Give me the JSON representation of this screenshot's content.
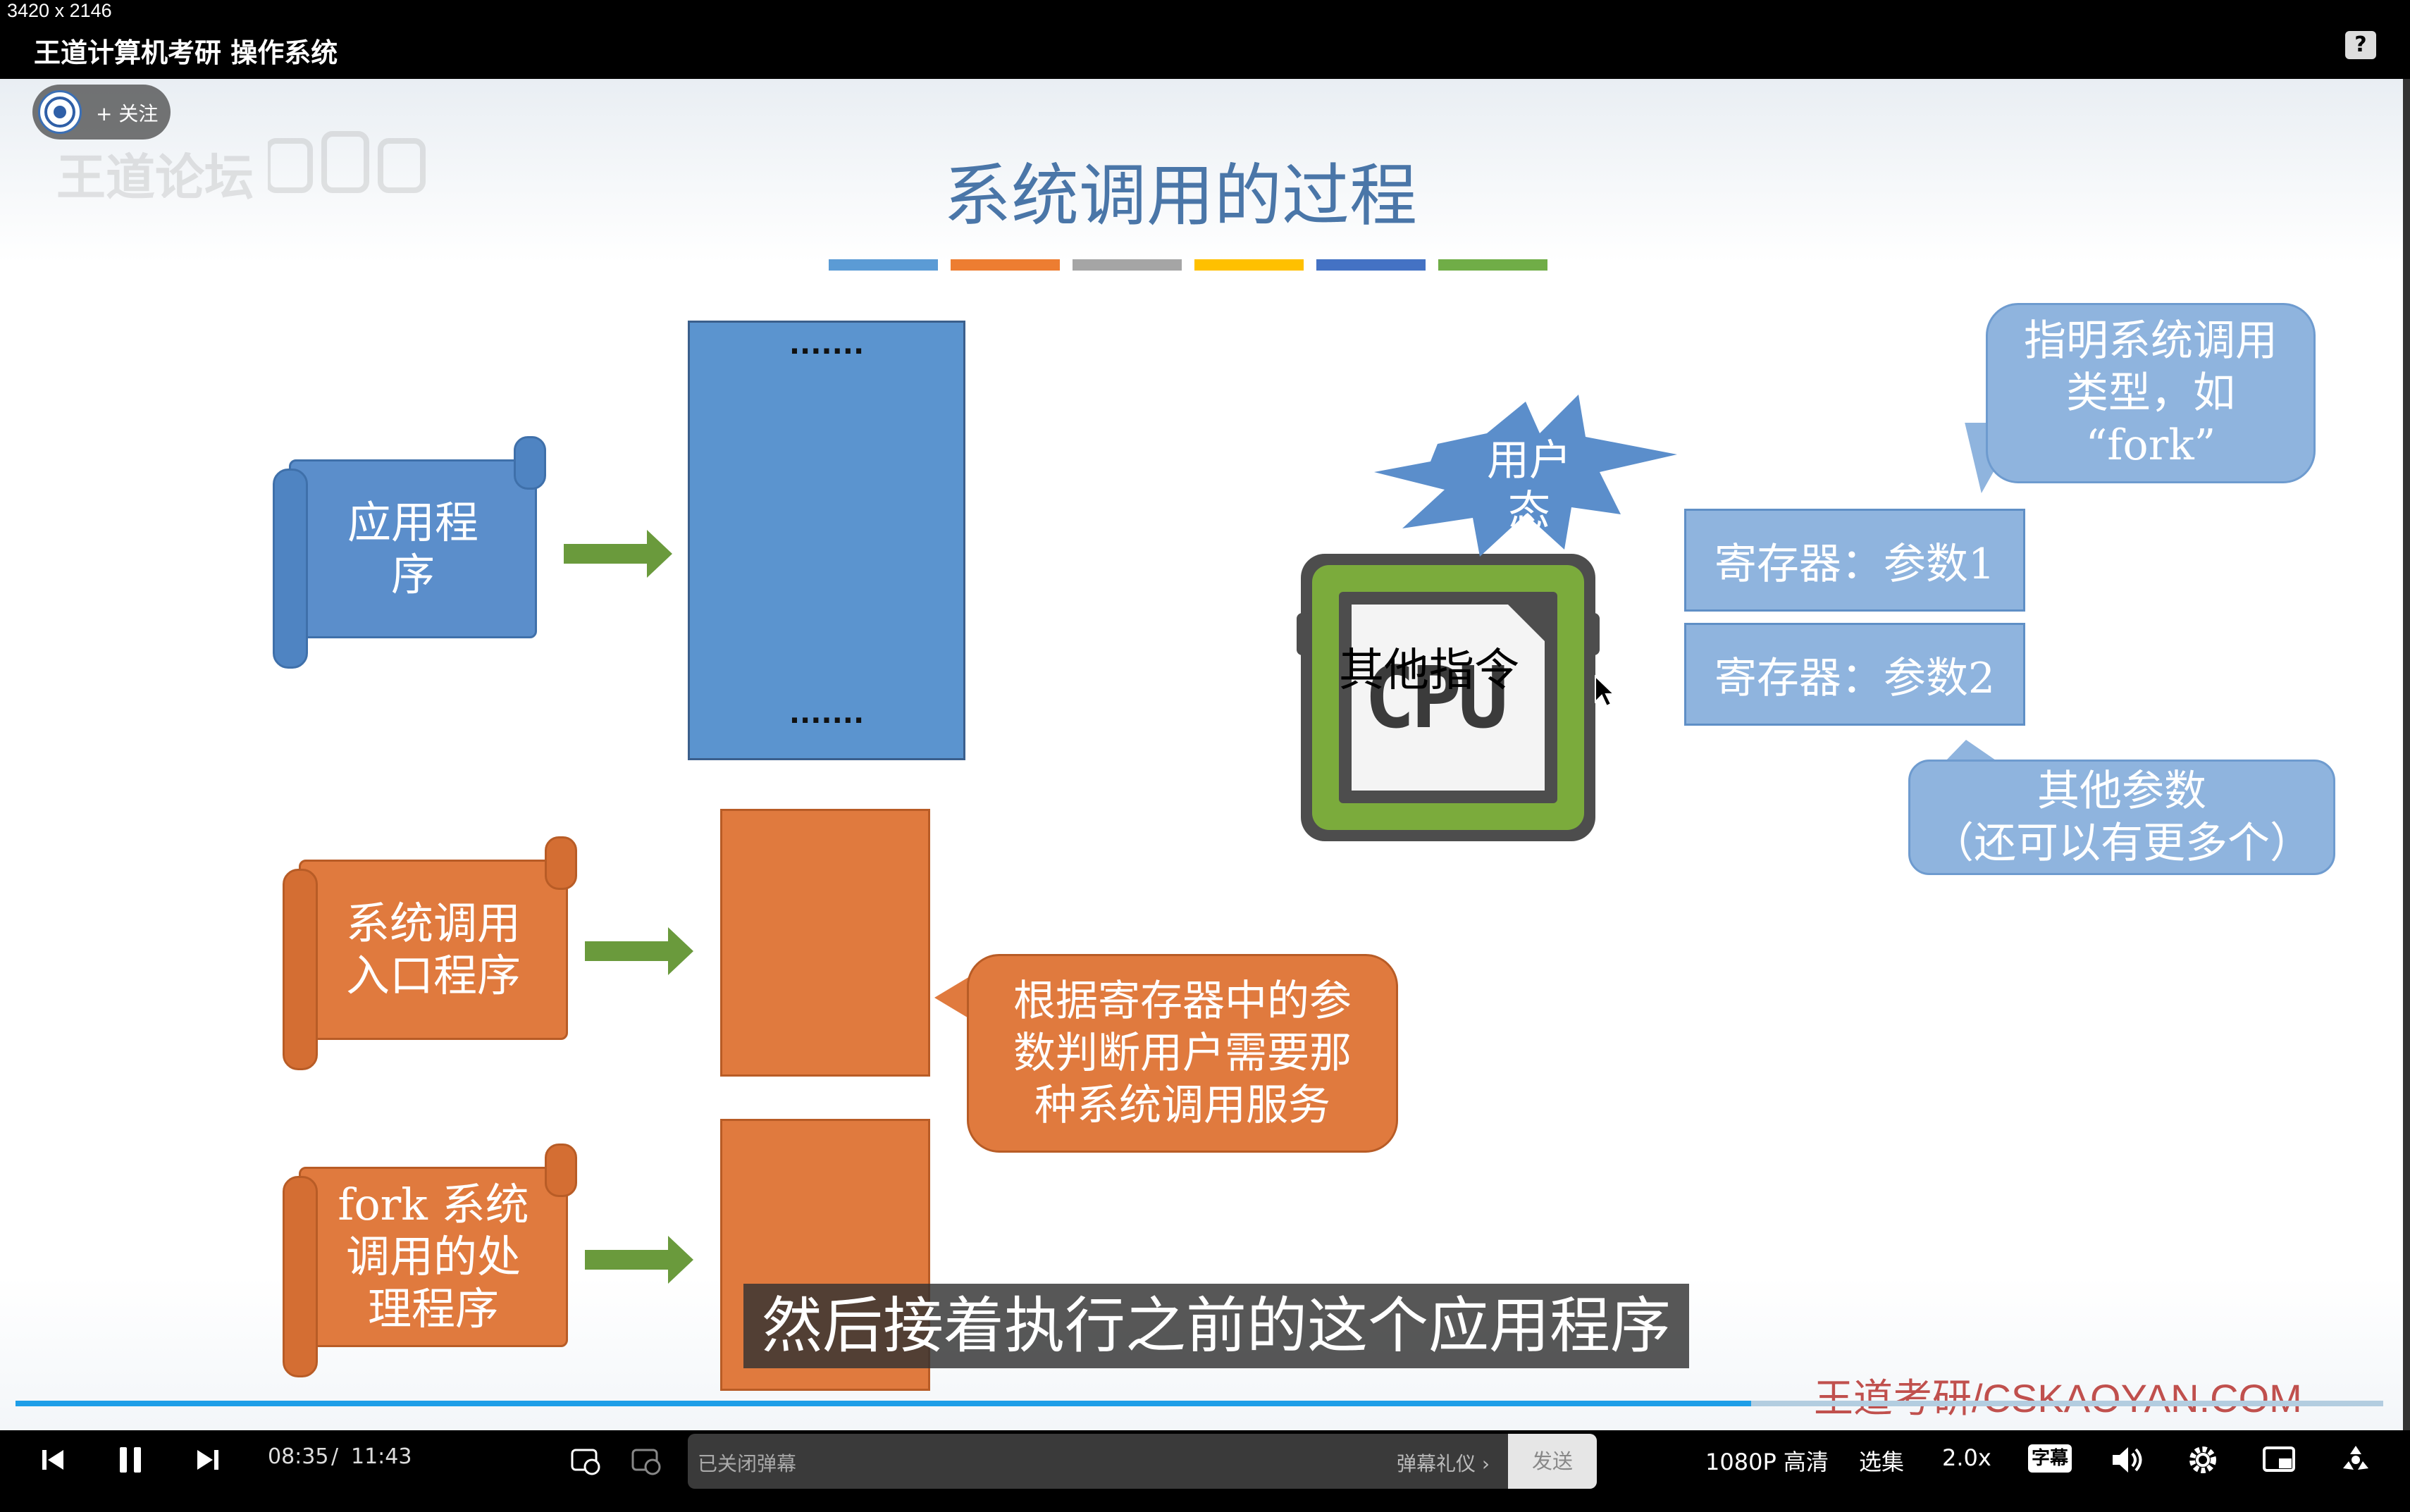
{
  "screen": {
    "size_label": "3420 x 2146"
  },
  "window": {
    "title": "王道计算机考研 操作系统",
    "help_label": "?"
  },
  "overlay": {
    "follow_label": "+ 关注",
    "watermark": "王道论坛"
  },
  "slide": {
    "title": "系统调用的过程",
    "color_bar": [
      "#5b9bd5",
      "#ed7d31",
      "#a5a5a5",
      "#ffc000",
      "#4472c4",
      "#70ad47"
    ],
    "scrolls": [
      {
        "label": "应用程\n序",
        "color": "#5b8ecb"
      },
      {
        "label": "系统调用\n入口程序",
        "color": "#e07a3e"
      },
      {
        "label": "fork 系统\n调用的处\n理程序",
        "color": "#e07a3e"
      }
    ],
    "code_block_dots_top": "·······",
    "code_block_dots_bottom": "·······",
    "cpu": {
      "chip_text": "CPU",
      "overlay_text": "其他指令",
      "burst_text": "用户\n态"
    },
    "callout_type": "指明系统调用\n类型，如\n“fork”",
    "registers": [
      "寄存器：参数1",
      "寄存器：参数2"
    ],
    "callout_other": "其他参数\n（还可以有更多个）",
    "callout_dispatch": "根据寄存器中的参\n数判断用户需要那\n种系统调用服务",
    "footer_brand": "王道考研/CSKAOYAN.COM"
  },
  "subtitle": "然后接着执行之前的这个应用程序",
  "player": {
    "current_time": "08:35",
    "separator": "/",
    "total_time": "11:43",
    "progress": 0.733,
    "danmaku_placeholder": "已关闭弹幕",
    "danmaku_gift": "弹幕礼仪 ›",
    "send_label": "发送",
    "quality": "1080P 高清",
    "episodes": "选集",
    "speed": "2.0x",
    "subtitle_label": "字幕"
  }
}
